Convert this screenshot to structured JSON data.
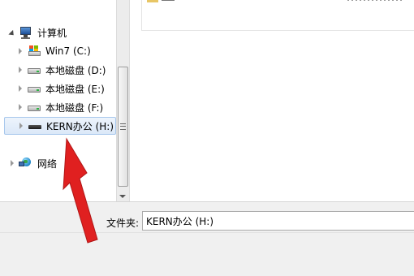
{
  "nav_tree": {
    "computer": {
      "label": "计算机",
      "icon": "computer-icon"
    },
    "drives": [
      {
        "label": "Win7 (C:)",
        "icon": "windows-drive-icon"
      },
      {
        "label": "本地磁盘 (D:)",
        "icon": "hard-drive-icon"
      },
      {
        "label": "本地磁盘 (E:)",
        "icon": "hard-drive-icon"
      },
      {
        "label": "本地磁盘 (F:)",
        "icon": "hard-drive-icon"
      },
      {
        "label": "KERN办公 (H:)",
        "icon": "usb-drive-icon",
        "selected": true
      }
    ],
    "network": {
      "label": "网络",
      "icon": "network-icon"
    }
  },
  "folder_field": {
    "label": "文件夹:",
    "value": "KERN办公 (H:)"
  },
  "annotation": {
    "arrow_color": "#e02020",
    "icon": "red-arrow-icon"
  },
  "colors": {
    "selection_bg": "#dbe8f8",
    "selection_border": "#a7c7ec",
    "panel_bg": "#f0f0f0"
  }
}
